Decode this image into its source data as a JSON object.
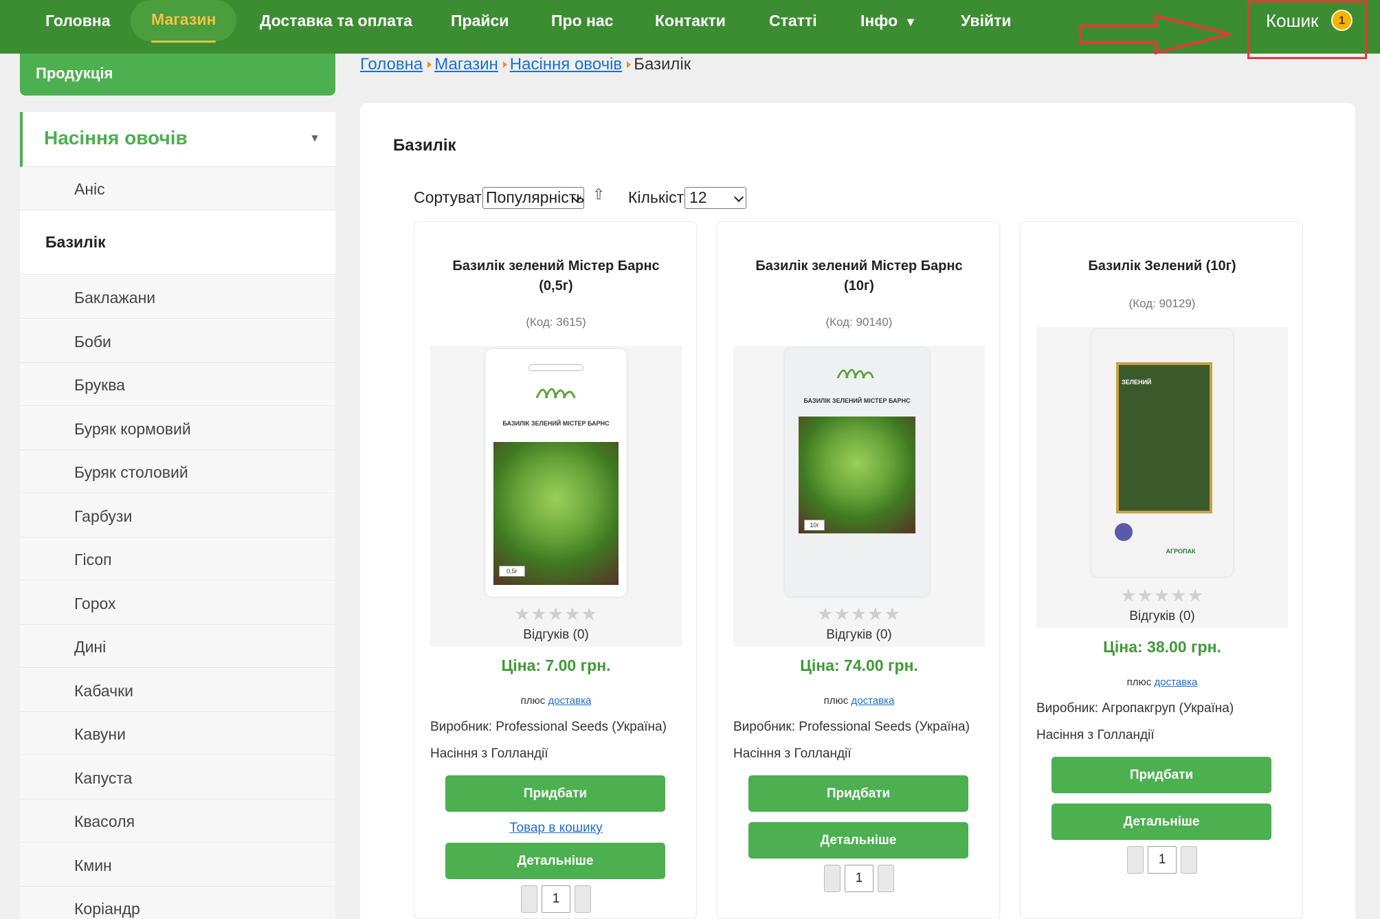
{
  "nav": {
    "items": [
      "Головна",
      "Магазин",
      "Доставка та оплата",
      "Прайси",
      "Про нас",
      "Контакти",
      "Статті",
      "Інфо",
      "Увійти"
    ],
    "info_caret": "▼",
    "cart_label": "Кошик",
    "cart_count": "1"
  },
  "sidebar": {
    "heading": "Продукція",
    "category": "Насіння овочів",
    "category_caret": "▼",
    "items": [
      "Аніс",
      "Базилік",
      "Баклажани",
      "Боби",
      "Бруква",
      "Буряк кормовий",
      "Буряк столовий",
      "Гарбузи",
      "Гісоп",
      "Горох",
      "Дині",
      "Кабачки",
      "Кавуни",
      "Капуста",
      "Квасоля",
      "Кмин",
      "Коріандр"
    ],
    "current": "Базилік"
  },
  "breadcrumb": {
    "links": [
      "Головна",
      "Магазин",
      "Насіння овочів"
    ],
    "current": "Базилік"
  },
  "page": {
    "title": "Базилік",
    "sort_label": "Сортувати:",
    "sort_value": "Популярність",
    "sort_dir_icon": "⇧",
    "qty_label": "Кількість:",
    "qty_value": "12"
  },
  "products": [
    {
      "title_lines": [
        "Базилік зелений Містер Барнс",
        "(0,5г)"
      ],
      "code": "(Код: 3615)",
      "pack_title": "БАЗИЛІК ЗЕЛЕНИЙ МІСТЕР БАРНС",
      "pack_size": "0,5г",
      "stars": "★★★★★",
      "reviews": "Відгуків (0)",
      "price": "Ціна: 7.00 грн.",
      "delivery_prefix": "плюс",
      "delivery_link": "доставка",
      "maker": "Виробник: Professional Seeds (Україна)",
      "origin": "Насіння з Голландії",
      "buy": "Придбати",
      "in_cart": "Товар в кошику",
      "details": "Детальніше",
      "qty": "1"
    },
    {
      "title_lines": [
        "Базилік зелений Містер Барнс",
        "(10г)"
      ],
      "code": "(Код: 90140)",
      "pack_title": "БАЗИЛІК ЗЕЛЕНИЙ МІСТЕР БАРНС",
      "pack_size": "10г",
      "stars": "★★★★★",
      "reviews": "Відгуків (0)",
      "price": "Ціна: 74.00 грн.",
      "delivery_prefix": "плюс",
      "delivery_link": "доставка",
      "maker": "Виробник: Professional Seeds (Україна)",
      "origin": "Насіння з Голландії",
      "buy": "Придбати",
      "details": "Детальніше",
      "qty": "1"
    },
    {
      "title_lines": [
        "Базилік Зелений (10г)"
      ],
      "code": "(Код: 90129)",
      "pack_title": "ЗЕЛЕНИЙ",
      "pack_brand": "АГРОПАК",
      "stars": "★★★★★",
      "reviews": "Відгуків (0)",
      "price": "Ціна: 38.00 грн.",
      "delivery_prefix": "плюс",
      "delivery_link": "доставка",
      "maker": "Виробник: Агропакгруп (Україна)",
      "origin": "Насіння з Голландії",
      "buy": "Придбати",
      "details": "Детальніше",
      "qty": "1"
    }
  ],
  "colors": {
    "nav_bg": "#3c8d32",
    "accent_green": "#4caf50",
    "price_green": "#3e9a35",
    "active_nav_text": "#f5c242",
    "highlight_red": "#e53935",
    "link_blue": "#1a6fd6"
  }
}
